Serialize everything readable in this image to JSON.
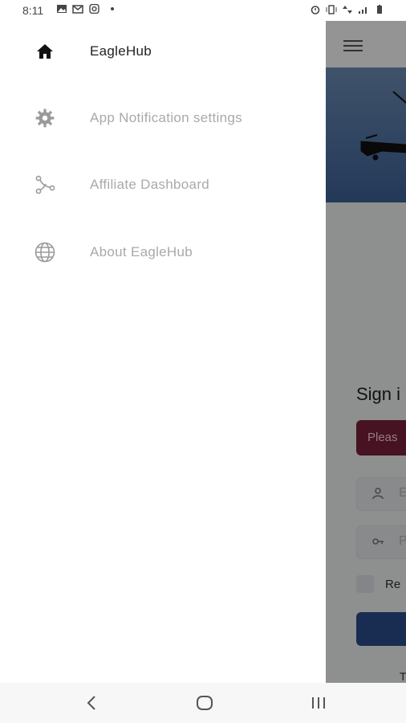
{
  "status_bar": {
    "time": "8:11"
  },
  "drawer": {
    "items": [
      {
        "label": "EagleHub",
        "icon": "home-icon",
        "state": "active"
      },
      {
        "label": "App Notification settings",
        "icon": "gear-icon",
        "state": "inactive"
      },
      {
        "label": "Affiliate Dashboard",
        "icon": "affiliate-icon",
        "state": "inactive"
      },
      {
        "label": "About EagleHub",
        "icon": "globe-icon",
        "state": "inactive"
      }
    ]
  },
  "background_app": {
    "sign_in_title": "Sign i",
    "alert_text": "Pleas",
    "username_placeholder": "E",
    "password_placeholder": "P",
    "remember_label": "Re",
    "footer_text": "T"
  },
  "colors": {
    "active_text": "#222222",
    "inactive_text": "#a9a9a9",
    "alert_bg": "#7b1f3a",
    "primary_button": "#2c4f8f"
  }
}
